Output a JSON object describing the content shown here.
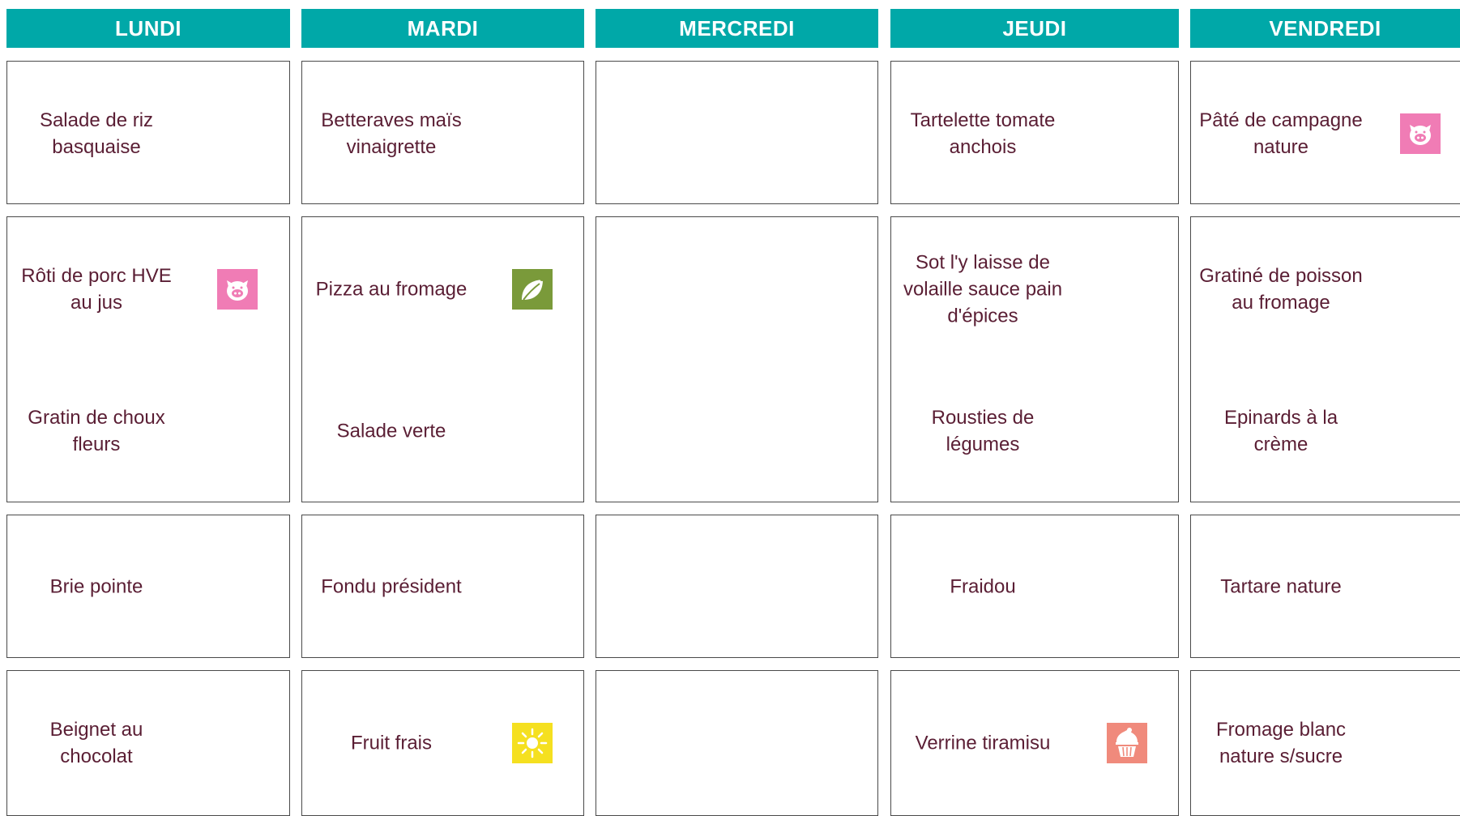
{
  "days": [
    "LUNDI",
    "MARDI",
    "MERCREDI",
    "JEUDI",
    "VENDREDI"
  ],
  "menu": {
    "lundi": {
      "starter": [
        "Salade de riz",
        "basquaise"
      ],
      "main": [
        "Rôti de porc HVE",
        "au jus"
      ],
      "side": [
        "Gratin de choux",
        "fleurs"
      ],
      "cheese": [
        "Brie pointe"
      ],
      "dessert": [
        "Beignet au",
        "chocolat"
      ]
    },
    "mardi": {
      "starter": [
        "Betteraves maïs",
        "vinaigrette"
      ],
      "main": [
        "Pizza au fromage"
      ],
      "side": [
        "Salade verte"
      ],
      "cheese": [
        "Fondu président"
      ],
      "dessert": [
        "Fruit frais"
      ]
    },
    "jeudi": {
      "starter": [
        "Tartelette tomate",
        "anchois"
      ],
      "main": [
        "Sot l'y laisse de",
        "volaille sauce pain",
        "d'épices"
      ],
      "side": [
        "Rousties de",
        "légumes"
      ],
      "cheese": [
        "Fraidou"
      ],
      "dessert": [
        "Verrine tiramisu"
      ]
    },
    "vendredi": {
      "starter": [
        "Pâté de campagne",
        "nature"
      ],
      "main": [
        "Gratiné de poisson",
        "au fromage"
      ],
      "side": [
        "Epinards à la",
        "crème"
      ],
      "cheese": [
        "Tartare nature"
      ],
      "dessert": [
        "Fromage blanc",
        "nature s/sucre"
      ]
    }
  },
  "icons": {
    "pork": {
      "name": "pig-icon",
      "color": "#f07cb5"
    },
    "vegetarian": {
      "name": "leaf-icon",
      "color": "#7a9a3a"
    },
    "seasonal": {
      "name": "sun-icon",
      "color": "#f5e020"
    },
    "homemade": {
      "name": "cupcake-icon",
      "color": "#f08a7c"
    }
  }
}
